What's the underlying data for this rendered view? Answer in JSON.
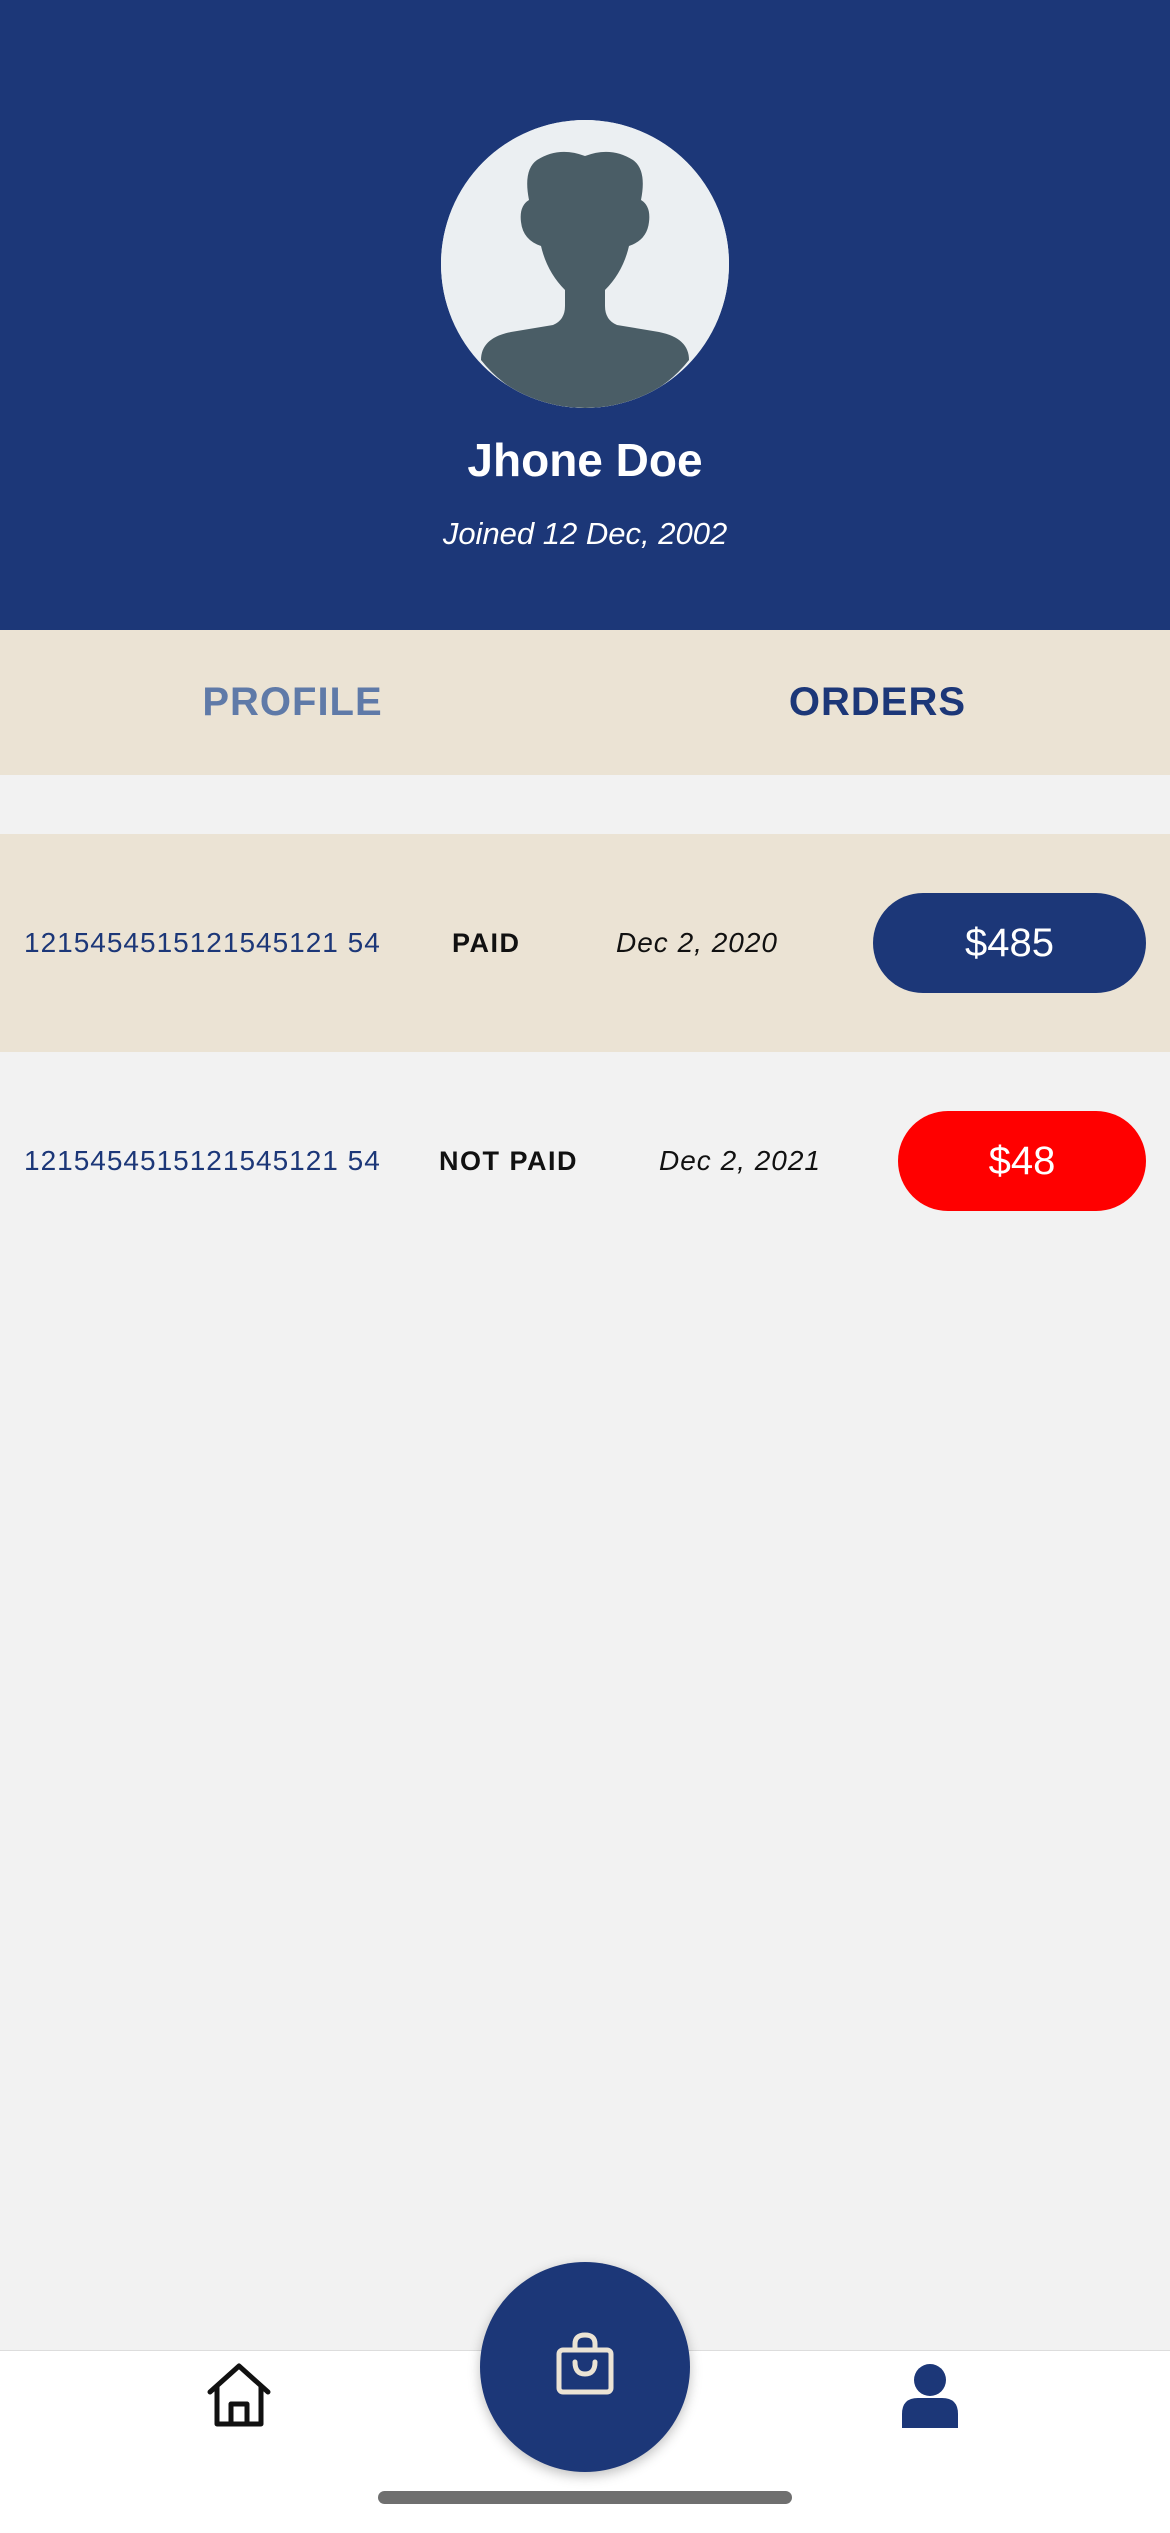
{
  "profile": {
    "name": "Jhone Doe",
    "joined": "Joined 12 Dec, 2002"
  },
  "tabs": [
    {
      "label": "PROFILE",
      "active": false
    },
    {
      "label": "ORDERS",
      "active": true
    }
  ],
  "orders": [
    {
      "id": "1215454515121545121 54",
      "status": "PAID",
      "date": "Dec 2, 2020",
      "amount": "$485",
      "amount_color": "#1c3778"
    },
    {
      "id": "1215454515121545121 54",
      "status": "NOT PAID",
      "date": "Dec 2, 2021",
      "amount": "$48",
      "amount_color": "#ff0000"
    }
  ],
  "nav": {
    "left_icon": "home-icon",
    "center_icon": "shopping-bag-icon",
    "right_icon": "user-icon"
  },
  "colors": {
    "primary": "#1c3778",
    "beige": "#ebe3d4",
    "danger": "#ff0000",
    "background": "#f2f2f2"
  }
}
